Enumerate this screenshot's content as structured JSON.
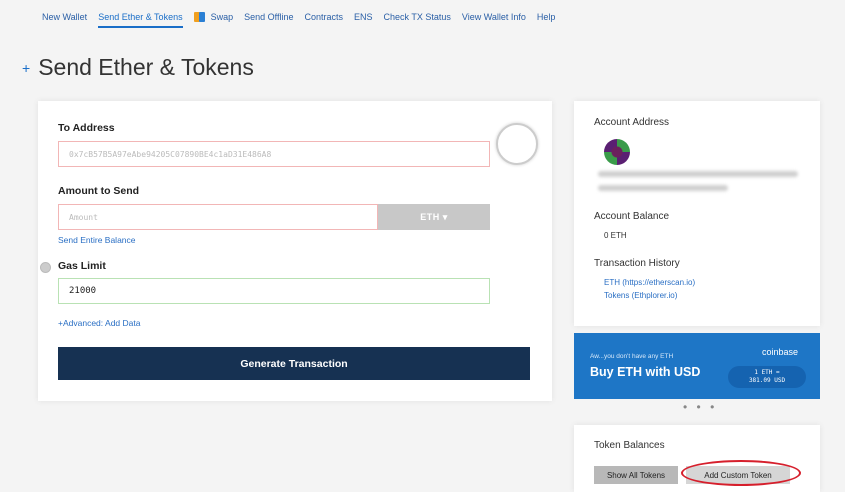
{
  "nav": {
    "items": [
      {
        "label": "New Wallet"
      },
      {
        "label": "Send Ether & Tokens",
        "active": true
      },
      {
        "label": "Swap",
        "icon": "swap-icon"
      },
      {
        "label": "Send Offline"
      },
      {
        "label": "Contracts"
      },
      {
        "label": "ENS"
      },
      {
        "label": "Check TX Status"
      },
      {
        "label": "View Wallet Info"
      },
      {
        "label": "Help"
      }
    ]
  },
  "page": {
    "title": "Send Ether & Tokens",
    "title_icon": "+"
  },
  "form": {
    "to_address_label": "To Address",
    "to_address_placeholder": "0x7cB57B5A97eAbe94205C07890BE4c1aD31E486A8",
    "amount_label": "Amount to Send",
    "amount_placeholder": "Amount",
    "currency_label": "ETH ▾",
    "send_entire_balance": "Send Entire Balance",
    "gas_limit_label": "Gas Limit",
    "gas_limit_value": "21000",
    "advanced_link": "+Advanced: Add Data",
    "generate_button": "Generate Transaction"
  },
  "account": {
    "address_label": "Account Address",
    "balance_label": "Account Balance",
    "balance_value": "0 ETH",
    "history_label": "Transaction History",
    "history_eth": "ETH (https://etherscan.io)",
    "history_tokens": "Tokens (Ethplorer.io)"
  },
  "coinbase": {
    "tagline": "Aw...you don't have any ETH",
    "headline": "Buy ETH with USD",
    "brand": "coinbase",
    "rate_line1": "1 ETH =",
    "rate_line2": "381.09 USD"
  },
  "more_dots": "• • •",
  "tokens": {
    "label": "Token Balances",
    "show_all": "Show All Tokens",
    "add_custom": "Add Custom Token"
  },
  "colors": {
    "accent": "#1a6ec8",
    "button_dark": "#163152",
    "coinbase_blue": "#1e76c6",
    "highlight_red": "#d61f2c"
  }
}
